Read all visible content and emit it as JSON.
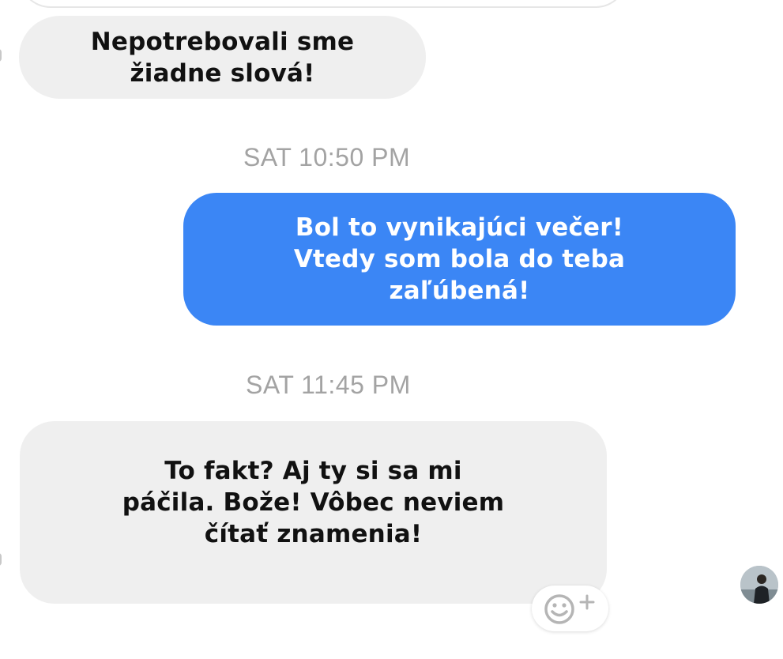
{
  "messages": [
    {
      "id": "m1",
      "direction": "received",
      "text": "Nepotrebovali sme\nžiadne slová!"
    },
    {
      "id": "ts1",
      "type": "timestamp",
      "text": "SAT 10:50 PM"
    },
    {
      "id": "m2",
      "direction": "sent",
      "text": "Bol to vynikajúci večer!\nVtedy som bola do teba\nzaľúbená!"
    },
    {
      "id": "ts2",
      "type": "timestamp",
      "text": "SAT 11:45 PM"
    },
    {
      "id": "m3",
      "direction": "received",
      "text": "To fakt? Aj ty si sa mi\npáčila. Bože! Vôbec neviem\nčítať znamenia!"
    }
  ],
  "reaction_button": {
    "icon": "smiley-add-icon"
  },
  "avatar": {
    "icon": "user-avatar"
  },
  "colors": {
    "sent_bubble": "#3b86f5",
    "received_bubble": "#efefef",
    "timestamp": "#a3a3a3",
    "background": "#ffffff"
  }
}
